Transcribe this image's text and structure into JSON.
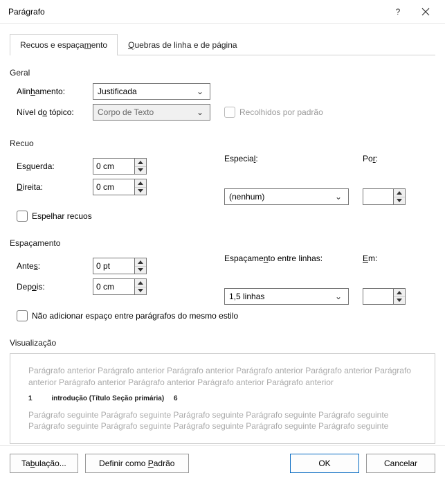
{
  "title": "Parágrafo",
  "tabs": {
    "indent": "Recuos e espaçamento",
    "breaks": "Quebras de linha e de página"
  },
  "general": {
    "label": "Geral",
    "alignment_label": "Alinhamento:",
    "alignment_value": "Justificada",
    "outline_label": "Nível do tópico:",
    "outline_value": "Corpo de Texto",
    "collapsed_label": "Recolhidos por padrão"
  },
  "indent": {
    "label": "Recuo",
    "left_label": "Esquerda:",
    "left_value": "0 cm",
    "right_label": "Direita:",
    "right_value": "0 cm",
    "mirror_label": "Espelhar recuos",
    "special_label": "Especial:",
    "special_value": "(nenhum)",
    "by_label": "Por:",
    "by_value": ""
  },
  "spacing": {
    "label": "Espaçamento",
    "before_label": "Antes:",
    "before_value": "0 pt",
    "after_label": "Depois:",
    "after_value": "0 cm",
    "no_add_label": "Não adicionar espaço entre parágrafos do mesmo estilo",
    "line_label": "Espaçamento entre linhas:",
    "line_value": "1,5 linhas",
    "at_label": "Em:",
    "at_value": ""
  },
  "preview": {
    "label": "Visualização",
    "prev_text": "Parágrafo anterior Parágrafo anterior Parágrafo anterior Parágrafo anterior Parágrafo anterior Parágrafo anterior Parágrafo anterior Parágrafo anterior Parágrafo anterior Parágrafo anterior",
    "sample": "1          introdução (Título Seção primária)     6",
    "next_text": "Parágrafo seguinte Parágrafo seguinte Parágrafo seguinte Parágrafo seguinte Parágrafo seguinte Parágrafo seguinte Parágrafo seguinte Parágrafo seguinte Parágrafo seguinte Parágrafo seguinte"
  },
  "buttons": {
    "tabs": "Tabulação...",
    "default": "Definir como Padrão",
    "ok": "OK",
    "cancel": "Cancelar"
  }
}
